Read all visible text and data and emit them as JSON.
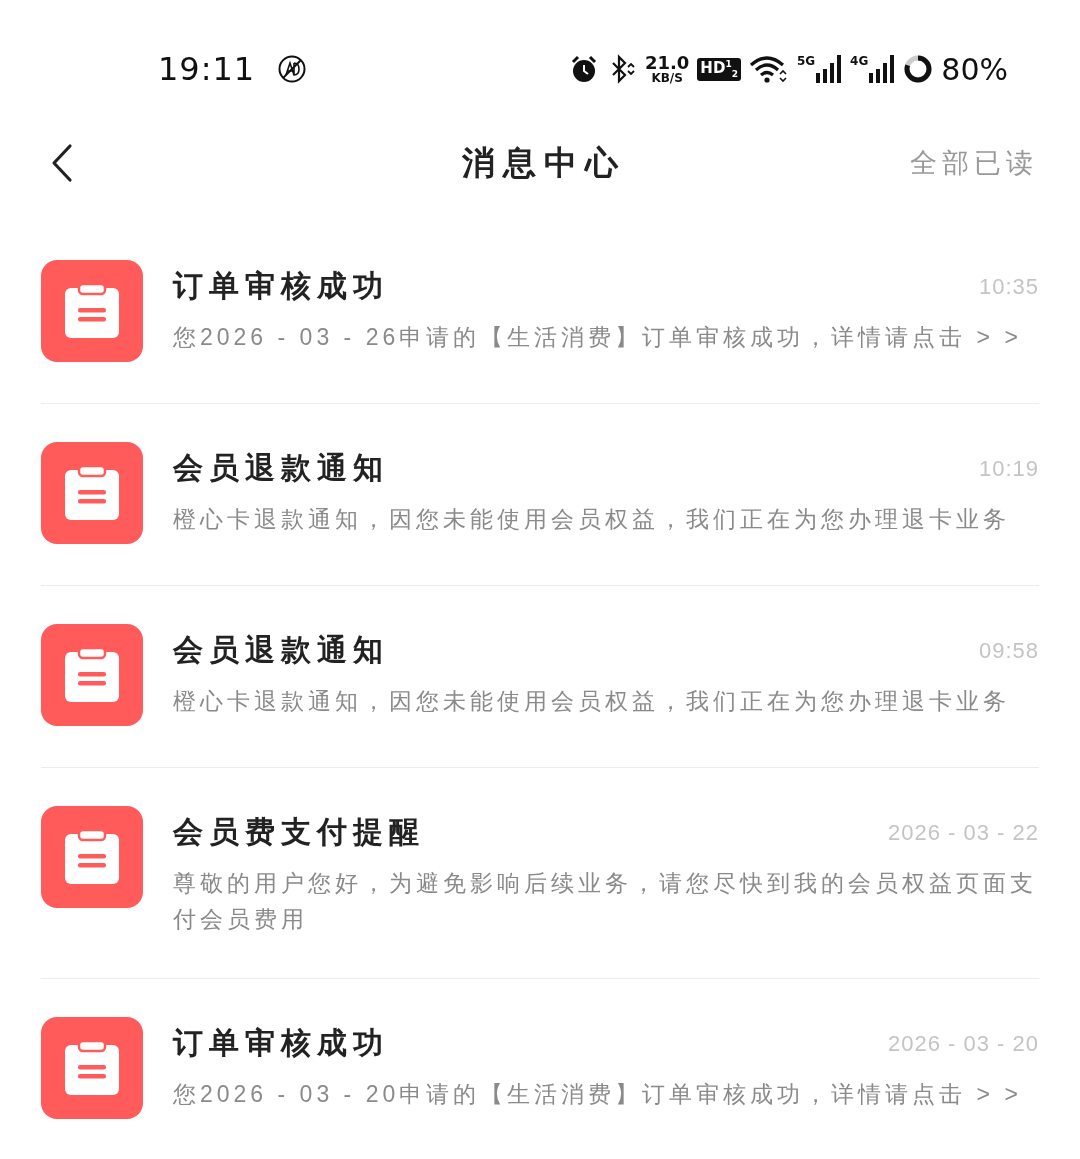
{
  "status_bar": {
    "time": "19:11",
    "speed_value": "21.0",
    "speed_unit": "KB/S",
    "hd_badge": "HD$^{1}$$_{2}$",
    "networks": [
      "5G",
      "4G"
    ],
    "battery": "80%"
  },
  "header": {
    "title": "消息中心",
    "action": "全部已读"
  },
  "messages": [
    {
      "title": "订单审核成功",
      "time": "10:35",
      "body": "您2026 - 03 - 26申请的【生活消费】订单审核成功，详情请点击 > >"
    },
    {
      "title": "会员退款通知",
      "time": "10:19",
      "body": "橙心卡退款通知，因您未能使用会员权益，我们正在为您办理退卡业务"
    },
    {
      "title": "会员退款通知",
      "time": "09:58",
      "body": "橙心卡退款通知，因您未能使用会员权益，我们正在为您办理退卡业务"
    },
    {
      "title": "会员费支付提醒",
      "time": "2026 - 03 - 22",
      "body": "尊敬的用户您好，为避免影响后续业务，请您尽快到我的会员权益页面支付会员费用"
    },
    {
      "title": "订单审核成功",
      "time": "2026 - 03 - 20",
      "body": "您2026 - 03 - 20申请的【生活消费】订单审核成功，详情请点击 > >"
    }
  ]
}
